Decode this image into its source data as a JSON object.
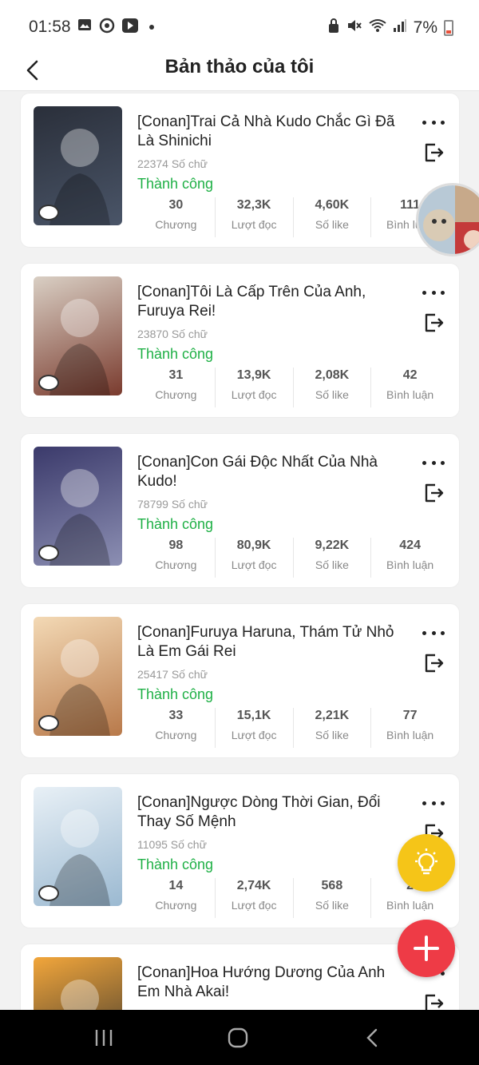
{
  "status_bar": {
    "time": "01:58",
    "battery": "7%",
    "left_icons": [
      "image-icon",
      "sync-icon",
      "play-icon",
      "dot-icon"
    ],
    "right_icons": [
      "lock-icon",
      "mute-icon",
      "wifi-icon",
      "signal-icon",
      "battery-icon"
    ]
  },
  "app_bar": {
    "title": "Bản thảo của tôi"
  },
  "stat_labels": {
    "chapters": "Chương",
    "reads": "Lượt đọc",
    "likes": "Số like",
    "comments": "Bình luận"
  },
  "drafts": [
    {
      "title": "[Conan]Trai Cả Nhà Kudo Chắc Gì Đã Là Shinichi",
      "word_count": "22374 Số chữ",
      "status": "Thành công",
      "chapters": "30",
      "reads": "32,3K",
      "likes": "4,60K",
      "comments": "111",
      "cover_colors": [
        "#2a2f3a",
        "#4a5568"
      ]
    },
    {
      "title": "[Conan]Tôi Là Cấp Trên Của Anh, Furuya Rei!",
      "word_count": "23870 Số chữ",
      "status": "Thành công",
      "chapters": "31",
      "reads": "13,9K",
      "likes": "2,08K",
      "comments": "42",
      "cover_colors": [
        "#d9cfc4",
        "#7a3b2e"
      ]
    },
    {
      "title": "[Conan]Con Gái Độc Nhất Của Nhà Kudo!",
      "word_count": "78799 Số chữ",
      "status": "Thành công",
      "chapters": "98",
      "reads": "80,9K",
      "likes": "9,22K",
      "comments": "424",
      "cover_colors": [
        "#3b3a6b",
        "#8c8fb3"
      ]
    },
    {
      "title": "[Conan]Furuya Haruna, Thám Tử Nhỏ Là Em Gái Rei",
      "word_count": "25417 Số chữ",
      "status": "Thành công",
      "chapters": "33",
      "reads": "15,1K",
      "likes": "2,21K",
      "comments": "77",
      "cover_colors": [
        "#f3d9b5",
        "#b8794a"
      ]
    },
    {
      "title": "[Conan]Ngược Dòng Thời Gian, Đổi Thay Số Mệnh",
      "word_count": "11095 Số chữ",
      "status": "Thành công",
      "chapters": "14",
      "reads": "2,74K",
      "likes": "568",
      "comments": "2",
      "cover_colors": [
        "#e8f0f6",
        "#9bb9d1"
      ]
    },
    {
      "title": "[Conan]Hoa Hướng Dương Của Anh Em Nhà Akai!",
      "word_count": "",
      "status": "",
      "chapters": "",
      "reads": "",
      "likes": "",
      "comments": "",
      "cover_colors": [
        "#f2a63b",
        "#2c2c2c"
      ]
    }
  ],
  "colors": {
    "success": "#1fb046",
    "fab_idea": "#f5c518",
    "fab_add": "#ee3b46"
  }
}
